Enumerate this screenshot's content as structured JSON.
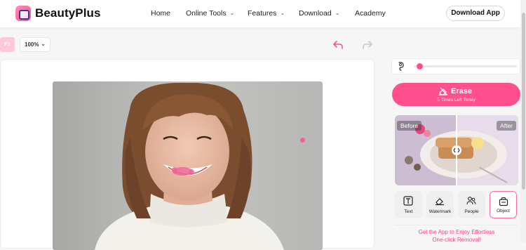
{
  "header": {
    "brand": "BeautyPlus",
    "nav": [
      {
        "label": "Home",
        "has_dropdown": false
      },
      {
        "label": "Online Tools",
        "has_dropdown": true
      },
      {
        "label": "Features",
        "has_dropdown": true
      },
      {
        "label": "Download",
        "has_dropdown": true
      },
      {
        "label": "Academy",
        "has_dropdown": false
      }
    ],
    "download_button": "Download App"
  },
  "toolbar": {
    "fit_label": "Fit",
    "zoom_value": "100%",
    "undo_icon": "undo-arrow-icon",
    "redo_icon": "redo-arrow-icon"
  },
  "brush": {
    "icon": "brush-size-icon",
    "size_fraction": 0.03
  },
  "erase": {
    "label": "Erase",
    "sublabel": "5 Times Left Today",
    "icon": "eraser-icon"
  },
  "compare": {
    "before_label": "Before",
    "after_label": "After",
    "handle_icon": "compare-arrows-icon"
  },
  "tools": [
    {
      "label": "Text",
      "icon": "text-icon",
      "active": false
    },
    {
      "label": "Watermark",
      "icon": "eraser-icon",
      "active": false
    },
    {
      "label": "People",
      "icon": "people-icon",
      "active": false
    },
    {
      "label": "Object",
      "icon": "object-box-icon",
      "active": true
    }
  ],
  "promo": {
    "line1": "Get the App to Enjoy Effortless",
    "line2": "One-click Removal!"
  },
  "colors": {
    "accent": "#ff4f8d",
    "accent_light": "#ffc7da"
  }
}
